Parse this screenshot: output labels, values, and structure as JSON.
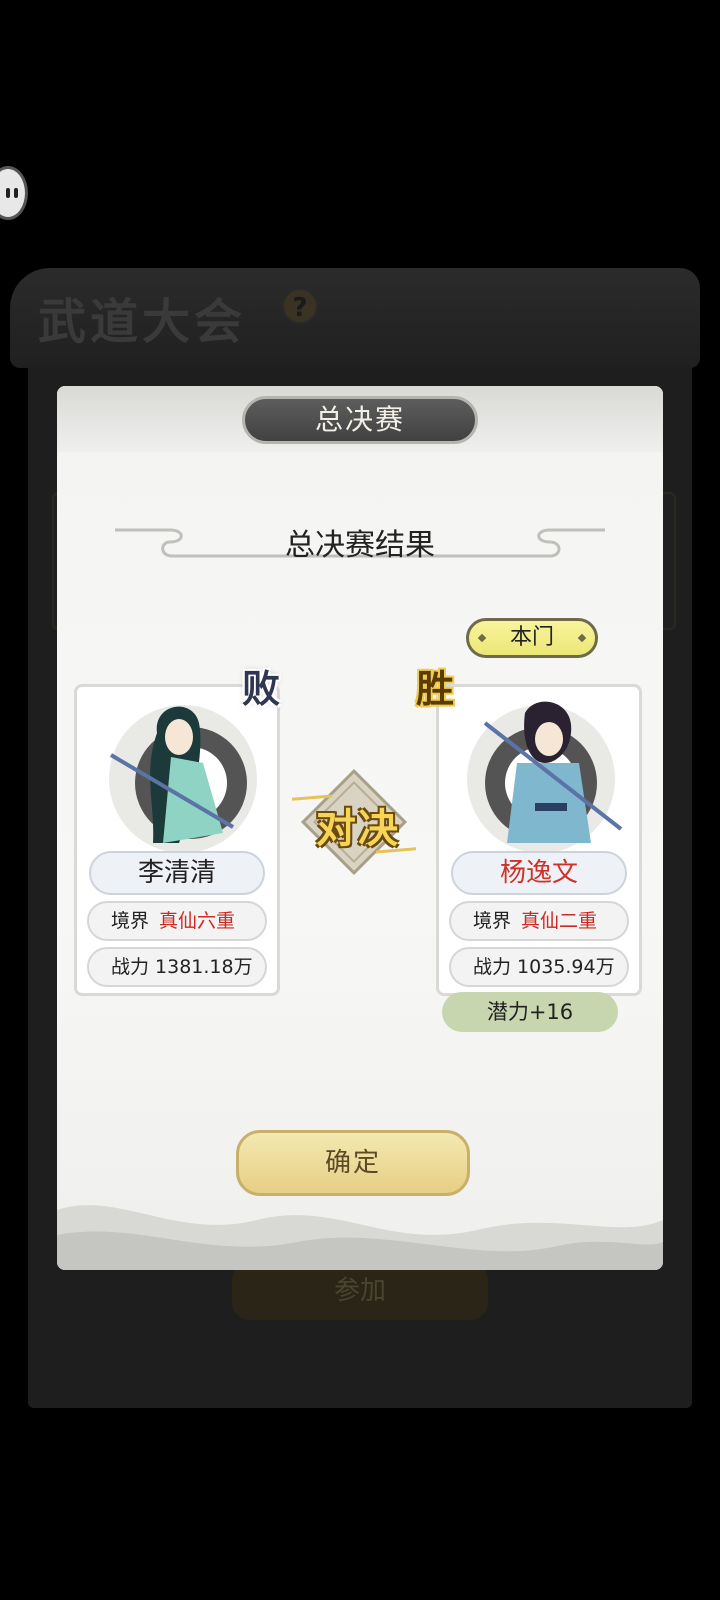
{
  "background": {
    "title": "武道大会",
    "help_icon": "?",
    "join_button": "参加"
  },
  "modal": {
    "tab_label": "总决赛",
    "result_title": "总决赛结果",
    "vs_label": "对决",
    "confirm_button": "确定"
  },
  "fighters": [
    {
      "result": "败",
      "name": "李清清",
      "realm_label": "境界",
      "realm_value": "真仙六重",
      "power_label": "战力",
      "power_value": "1381.18万"
    },
    {
      "result": "胜",
      "badge": "本门",
      "name": "杨逸文",
      "realm_label": "境界",
      "realm_value": "真仙二重",
      "power_label": "战力",
      "power_value": "1035.94万",
      "reward": "潜力+16"
    }
  ]
}
